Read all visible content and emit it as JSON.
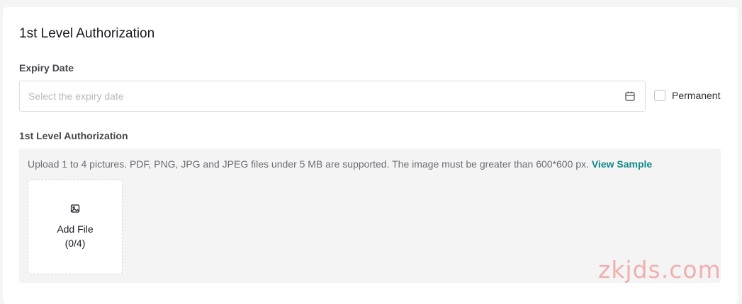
{
  "section": {
    "title": "1st Level Authorization"
  },
  "expiry": {
    "label": "Expiry Date",
    "placeholder": "Select the expiry date",
    "permanent_label": "Permanent",
    "permanent_checked": false
  },
  "authorization": {
    "label": "1st Level Authorization",
    "upload_hint": "Upload 1 to 4 pictures. PDF, PNG, JPG and JPEG files under 5 MB are supported. The image must be greater than 600*600 px.",
    "view_sample_link": "View Sample",
    "add_file_label": "Add File",
    "add_file_count": "(0/4)"
  },
  "watermark": {
    "text": "zkjds.com"
  },
  "icons": {
    "calendar": "calendar-icon",
    "image": "image-icon"
  },
  "colors": {
    "accent": "#138a8a",
    "watermark": "#f0a3a3"
  }
}
